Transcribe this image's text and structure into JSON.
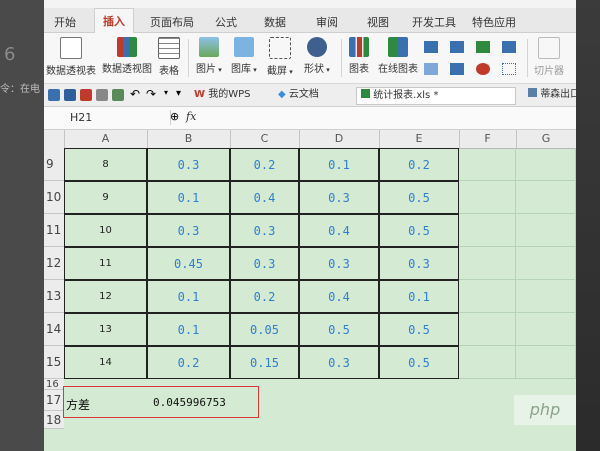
{
  "background": {
    "left_big": "6",
    "left_small": "令：在电",
    "left_colon": ":"
  },
  "tabs": [
    "开始",
    "插入",
    "页面布局",
    "公式",
    "数据",
    "审阅",
    "视图",
    "开发工具",
    "特色应用"
  ],
  "active_tab": "插入",
  "ribbon": {
    "pivot_table": "数据透视表",
    "pivot_chart": "数据透视图",
    "table": "表格",
    "picture": "图片",
    "gallery": "图库",
    "screenshot": "截屏",
    "shapes": "形状",
    "chart": "图表",
    "online_chart": "在线图表",
    "slicer": "切片器"
  },
  "quick_access": {
    "my_wps": "我的WPS",
    "cloud_docs": "云文档",
    "current_file": "统计报表.xls *",
    "other_tab": "蒂森出口"
  },
  "formula_bar": {
    "cell_ref": "H21",
    "fx_label": "fx",
    "formula": ""
  },
  "columns": [
    "A",
    "B",
    "C",
    "D",
    "E",
    "F",
    "G"
  ],
  "rows": [
    {
      "num": "9",
      "a": "8",
      "b": "0.3",
      "c": "0.2",
      "d": "0.1",
      "e": "0.2"
    },
    {
      "num": "10",
      "a": "9",
      "b": "0.1",
      "c": "0.4",
      "d": "0.3",
      "e": "0.5"
    },
    {
      "num": "11",
      "a": "10",
      "b": "0.3",
      "c": "0.3",
      "d": "0.4",
      "e": "0.5"
    },
    {
      "num": "12",
      "a": "11",
      "b": "0.45",
      "c": "0.3",
      "d": "0.3",
      "e": "0.3"
    },
    {
      "num": "13",
      "a": "12",
      "b": "0.1",
      "c": "0.2",
      "d": "0.4",
      "e": "0.1"
    },
    {
      "num": "14",
      "a": "13",
      "b": "0.1",
      "c": "0.05",
      "d": "0.5",
      "e": "0.5"
    },
    {
      "num": "15",
      "a": "14",
      "b": "0.2",
      "c": "0.15",
      "d": "0.3",
      "e": "0.5"
    }
  ],
  "extra_rows": [
    "16",
    "17",
    "18"
  ],
  "result": {
    "label": "方差",
    "value": "0.045996753"
  },
  "watermark": "php",
  "colors": {
    "grid_bg": "#d4ead2",
    "value_blue": "#2f7fd1",
    "highlight_red": "#d9383a",
    "active_tab": "#c0392b"
  }
}
